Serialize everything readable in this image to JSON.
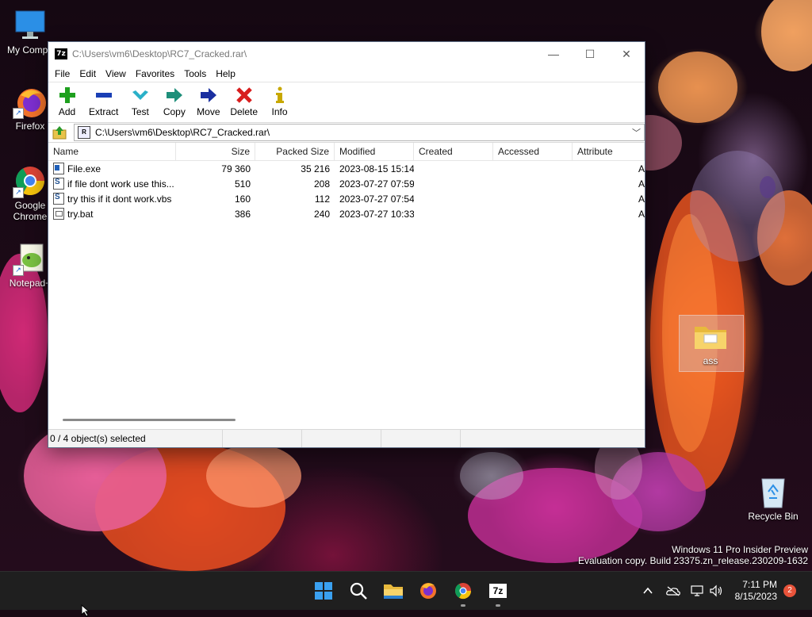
{
  "desktop": {
    "icons": [
      {
        "label": "My Compu"
      },
      {
        "label": "Firefox"
      },
      {
        "label": "Google Chrome"
      },
      {
        "label": "Notepad+"
      },
      {
        "label": "ass"
      },
      {
        "label": "Recycle Bin"
      }
    ],
    "watermark": {
      "line1": "Windows 11 Pro Insider Preview",
      "line2": "Evaluation copy. Build 23375.zn_release.230209-1632"
    }
  },
  "window": {
    "icon_text": "7z",
    "title": "C:\\Users\\vm6\\Desktop\\RC7_Cracked.rar\\",
    "controls": {
      "minimize": "—",
      "maximize": "☐",
      "close": "✕"
    },
    "menu": [
      "File",
      "Edit",
      "View",
      "Favorites",
      "Tools",
      "Help"
    ],
    "toolbar": [
      {
        "label": "Add",
        "icon": "plus-icon",
        "color": "#1ea01e"
      },
      {
        "label": "Extract",
        "icon": "minus-icon",
        "color": "#1a3fb5"
      },
      {
        "label": "Test",
        "icon": "check-icon",
        "color": "#2ab0c8"
      },
      {
        "label": "Copy",
        "icon": "copy-arrow-icon",
        "color": "#1e8f7a"
      },
      {
        "label": "Move",
        "icon": "move-arrow-icon",
        "color": "#1a2fa0"
      },
      {
        "label": "Delete",
        "icon": "x-icon",
        "color": "#d81e1e"
      },
      {
        "label": "Info",
        "icon": "info-icon",
        "color": "#c8a800"
      }
    ],
    "address": {
      "path": "C:\\Users\\vm6\\Desktop\\RC7_Cracked.rar\\"
    },
    "columns": [
      "Name",
      "Size",
      "Packed Size",
      "Modified",
      "Created",
      "Accessed",
      "Attribute"
    ],
    "files": [
      {
        "name": "File.exe",
        "size": "79 360",
        "packed": "35 216",
        "modified": "2023-08-15 15:14",
        "created": "",
        "accessed": "",
        "attr": "A",
        "type": "exe"
      },
      {
        "name": "if file dont work use this...",
        "size": "510",
        "packed": "208",
        "modified": "2023-07-27 07:59",
        "created": "",
        "accessed": "",
        "attr": "A",
        "type": "vbs"
      },
      {
        "name": "try this if it dont work.vbs",
        "size": "160",
        "packed": "112",
        "modified": "2023-07-27 07:54",
        "created": "",
        "accessed": "",
        "attr": "A",
        "type": "vbs"
      },
      {
        "name": "try.bat",
        "size": "386",
        "packed": "240",
        "modified": "2023-07-27 10:33",
        "created": "",
        "accessed": "",
        "attr": "A",
        "type": "bat"
      }
    ],
    "status": {
      "selection": "0 / 4 object(s) selected"
    }
  },
  "taskbar": {
    "apps": [
      {
        "name": "start"
      },
      {
        "name": "search"
      },
      {
        "name": "file-explorer"
      },
      {
        "name": "firefox"
      },
      {
        "name": "chrome",
        "running": true
      },
      {
        "name": "7zip",
        "running": true,
        "label": "7z"
      }
    ],
    "clock": {
      "time": "7:11 PM",
      "date": "8/15/2023"
    },
    "notifications": "2"
  }
}
